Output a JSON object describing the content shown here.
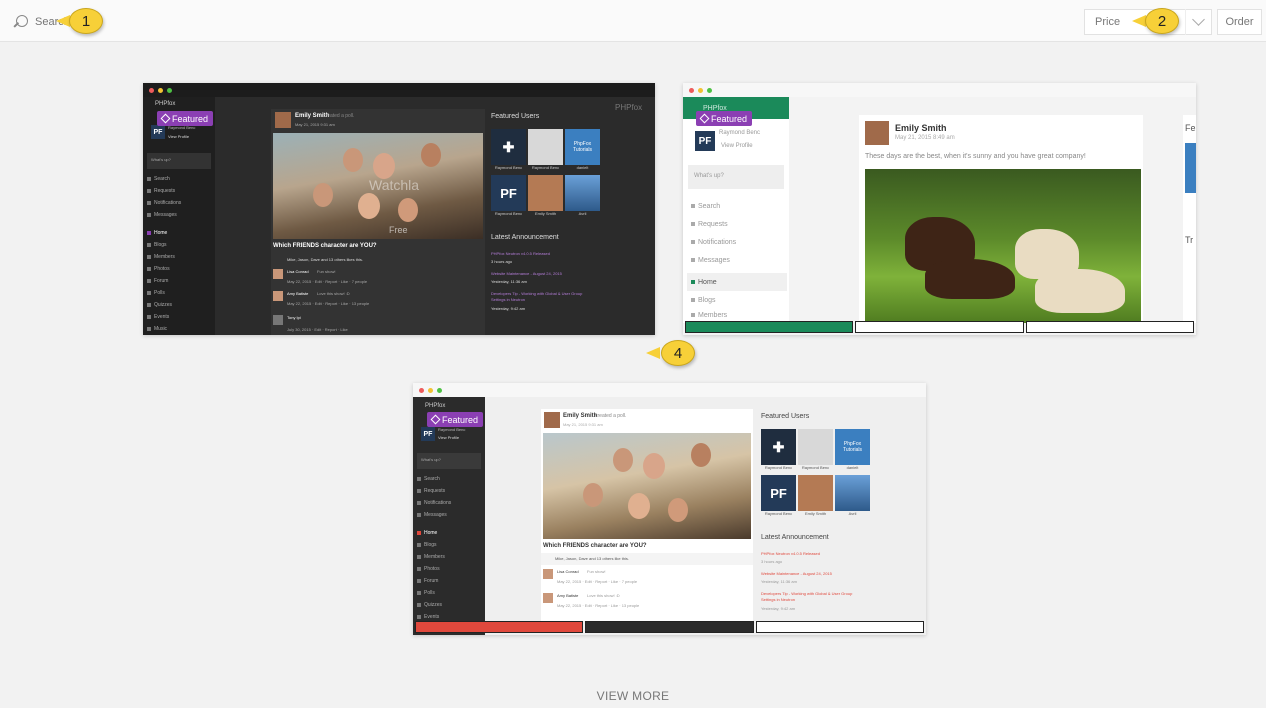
{
  "search": {
    "placeholder": "Search"
  },
  "sort": {
    "price_label": "Price",
    "order_label": "Order"
  },
  "callouts": [
    "1",
    "2",
    "4"
  ],
  "themes": [
    {
      "brand": "PHPfox",
      "badge": "Featured",
      "user_name": "Raymond Benc",
      "view_profile": "View Profile",
      "whats_up": "What's up?",
      "menu": [
        "Search",
        "Requests",
        "Notifications",
        "Messages",
        "Home",
        "Blogs",
        "Members",
        "Photos",
        "Forum",
        "Polls",
        "Quizzes",
        "Events",
        "Music"
      ],
      "post_author": "Emily Smith",
      "post_action": "created a poll.",
      "post_time": "May 21, 2015 9:31 am",
      "poll_question": "Which FRIENDS character are YOU?",
      "watermark": "Watchla",
      "free_label": "Free",
      "likes": "Mike, Jason, Dave and 13 others likes this.",
      "comments": [
        {
          "name": "Lisa Conrad",
          "text": "Fun show!",
          "meta": "May 22, 2015 · Edit · Report · Like · 7 people"
        },
        {
          "name": "Amy Batiste",
          "text": "Love this show! :D",
          "meta": "May 22, 2015 · Edit · Report · Like · 13 people"
        },
        {
          "name": "Tony Ipi",
          "text": "",
          "meta": "July 30, 2015 · Edit · Report · Like"
        }
      ],
      "featured_users_title": "Featured Users",
      "featured_users": [
        "Raymond Benc",
        "Raymond Benc",
        "PhpFox Tutorials",
        "PF",
        "Emily Smith",
        "Avril"
      ],
      "announce_title": "Latest Announcement",
      "announcements": [
        {
          "title": "PHPfox Neutron v4.0.5 Released",
          "time": "3 hours ago"
        },
        {
          "title": "Website Maintenance - August 24, 2015",
          "time": "Yesterday, 11:36 am"
        },
        {
          "title": "Developers Tip - Working with Global & User Group Settings in Neutron",
          "time": "Yesterday, 9:42 am"
        }
      ]
    },
    {
      "brand": "PHPfox",
      "badge": "Featured",
      "user_name": "Raymond Benc",
      "view_profile": "View Profile",
      "whats_up": "What's up?",
      "menu": [
        "Search",
        "Requests",
        "Notifications",
        "Messages",
        "Home",
        "Blogs",
        "Members"
      ],
      "post_author": "Emily Smith",
      "post_time": "May 21, 2015 8:49 am",
      "post_text": "These days are the best, when it's sunny and you have great company!",
      "right_col": [
        "Fe",
        "Tr"
      ],
      "swatches": [
        "#1b8a5a",
        "#ffffff",
        "#ffffff"
      ]
    },
    {
      "brand": "PHPfox",
      "badge": "Featured",
      "user_name": "Raymond Benc",
      "view_profile": "View Profile",
      "whats_up": "What's up?",
      "menu": [
        "Search",
        "Requests",
        "Notifications",
        "Messages",
        "Home",
        "Blogs",
        "Members",
        "Photos",
        "Forum",
        "Polls",
        "Quizzes",
        "Events"
      ],
      "post_author": "Emily Smith",
      "post_action": "created a poll.",
      "post_time": "May 21, 2015 9:31 am",
      "poll_question": "Which FRIENDS character are YOU?",
      "likes": "Mike, Jason, Dave and 13 others like this.",
      "comments": [
        {
          "name": "Lisa Conrad",
          "text": "Fun show!",
          "meta": "May 22, 2015 · Edit · Report · Like · 7 people"
        },
        {
          "name": "Amy Batiste",
          "text": "Love this show! :D",
          "meta": "May 22, 2015 · Edit · Report · Like · 13 people"
        }
      ],
      "featured_users_title": "Featured Users",
      "featured_users": [
        "Raymond Benc",
        "Raymond Benc",
        "PhpFox Tutorials",
        "Raymond Benc",
        "Emily Smith",
        "Avril"
      ],
      "announce_title": "Latest Announcement",
      "announcements": [
        {
          "title": "PHPfox Neutron v4.0.5 Released",
          "time": "3 hours ago"
        },
        {
          "title": "Website Maintenance - August 24, 2015",
          "time": "Yesterday, 11:36 am"
        },
        {
          "title": "Developers Tip - Working with Global & User Group Settings in Neutron",
          "time": "Yesterday, 9:42 am"
        }
      ],
      "swatches": [
        "#e0483c",
        "#2b2b2b",
        "#ffffff"
      ]
    }
  ],
  "view_more": "VIEW MORE",
  "colors": {
    "badge": "#8b3fb3",
    "callout": "#f7d038",
    "dark_bg": "#2b2b2b",
    "green": "#1b8a5a",
    "red": "#e0483c"
  }
}
